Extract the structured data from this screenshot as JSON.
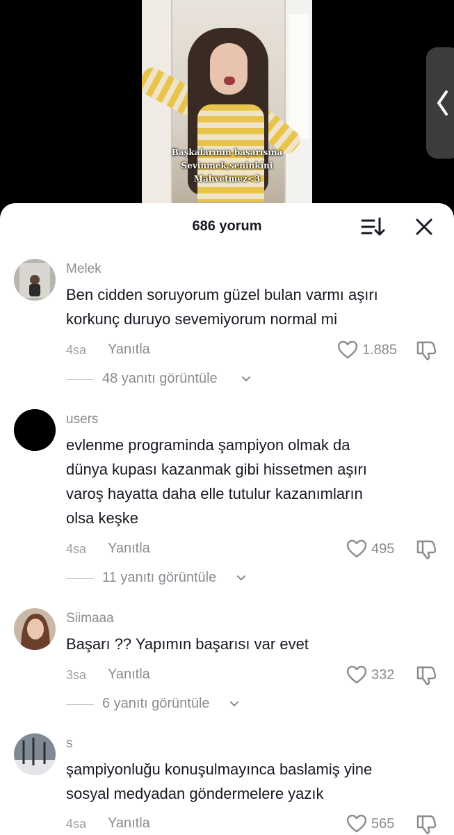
{
  "video": {
    "caption_lines": [
      "Başkalarının başarısına",
      "Sevinmek,seninkini",
      "Mahvetmez<3"
    ]
  },
  "header": {
    "title": "686 yorum"
  },
  "colors": {
    "text_primary": "#161823",
    "text_secondary": "#8a8b91",
    "sheet_bg": "#ffffff",
    "video_bg": "#000000"
  },
  "comments": [
    {
      "username": "Melek",
      "text_lines": [
        "Ben cidden soruyorum güzel bulan varmı aşırı",
        "korkunç duruyo sevemiyorum normal mi"
      ],
      "time": "4sa",
      "reply_label": "Yanıtla",
      "likes": "1.885",
      "view_replies": "48 yanıtı görüntüle",
      "avatar_icon": "photo-avatar"
    },
    {
      "username": "users",
      "text_lines": [
        "evlenme programinda şampiyon olmak da",
        "dünya kupası kazanmak gibi hissetmen aşırı",
        "varoş hayatta daha elle tutulur kazanımların",
        "olsa keşke"
      ],
      "time": "4sa",
      "reply_label": "Yanıtla",
      "likes": "495",
      "view_replies": "11 yanıtı görüntüle",
      "avatar_icon": "black-circle-avatar"
    },
    {
      "username": "Siimaaa",
      "text_lines": [
        "Başarı ?? Yapımın başarısı var evet"
      ],
      "time": "3sa",
      "reply_label": "Yanıtla",
      "likes": "332",
      "view_replies": "6 yanıtı görüntüle",
      "avatar_icon": "photo-avatar"
    },
    {
      "username": "s",
      "text_lines": [
        "şampiyonluğu konuşulmayınca baslamiş yine",
        "sosyal medyadan göndermelere yazık"
      ],
      "time": "4sa",
      "reply_label": "Yanıtla",
      "likes": "565",
      "avatar_icon": "photo-avatar"
    }
  ]
}
